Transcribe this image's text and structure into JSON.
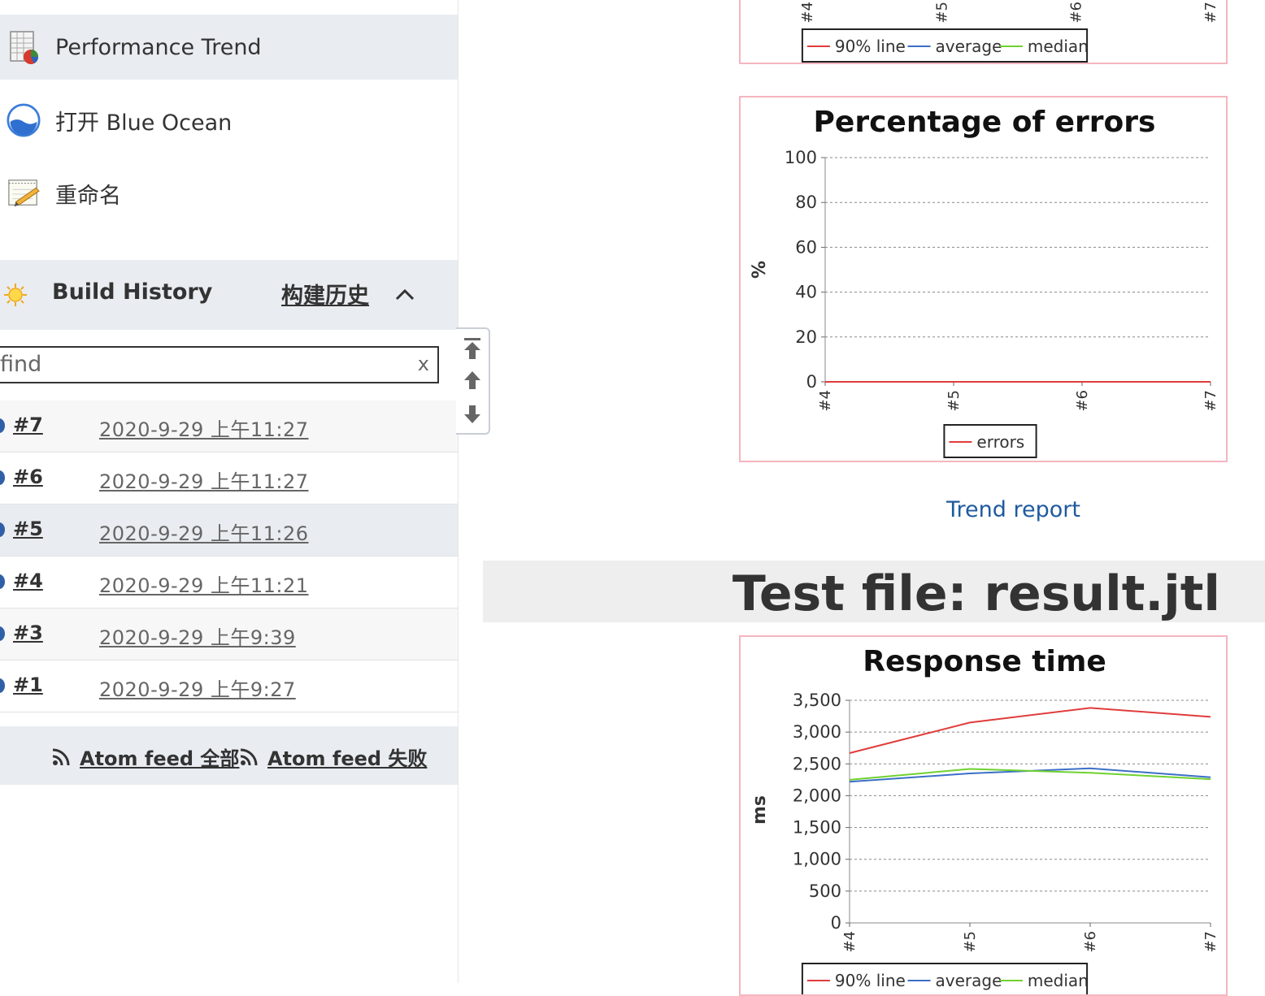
{
  "sidebar": {
    "tasks": [
      {
        "label": "Performance Trend",
        "icon": "performance-trend-icon"
      },
      {
        "label": "打开 Blue Ocean",
        "icon": "blue-ocean-icon"
      },
      {
        "label": "重命名",
        "icon": "rename-icon"
      }
    ],
    "build_history": {
      "title": "Build History",
      "link": "构建历史",
      "icon": "sun-icon",
      "collapse_icon": "chevron-up-icon",
      "search_placeholder": "find",
      "clear_label": "x",
      "builds": [
        {
          "number": "#7",
          "date": "2020-9-29 上午11:27"
        },
        {
          "number": "#6",
          "date": "2020-9-29 上午11:27"
        },
        {
          "number": "#5",
          "date": "2020-9-29 上午11:26"
        },
        {
          "number": "#4",
          "date": "2020-9-29 上午11:21"
        },
        {
          "number": "#3",
          "date": "2020-9-29 上午9:39"
        },
        {
          "number": "#1",
          "date": "2020-9-29 上午9:27"
        }
      ]
    },
    "atom_feeds": [
      {
        "label": "Atom feed 全部",
        "icon": "rss-icon"
      },
      {
        "label": "Atom feed 失败",
        "icon": "rss-icon"
      }
    ]
  },
  "main": {
    "trend_link": "Trend report",
    "test_file_heading": "Test file: result.jtl"
  },
  "colors": {
    "line_90": "#e03c3c",
    "line_average": "#3b6fc6",
    "line_median": "#6fd12f",
    "errors": "#e03c3c",
    "chart_border": "#f4b6c0",
    "link_blue": "#1f5a9f"
  },
  "chart_data": [
    {
      "type": "line",
      "partial": true,
      "x": [
        "#4",
        "#5",
        "#6",
        "#7"
      ],
      "legend": [
        "90% line",
        "average",
        "median"
      ]
    },
    {
      "type": "line",
      "title": "Percentage of errors",
      "ylabel": "%",
      "x": [
        "#4",
        "#5",
        "#6",
        "#7"
      ],
      "ylim": [
        0,
        100
      ],
      "yticks": [
        "0",
        "20",
        "40",
        "60",
        "80",
        "100"
      ],
      "series": [
        {
          "name": "errors",
          "values": [
            0,
            0,
            0,
            0
          ]
        }
      ],
      "grid": true,
      "legend_position": "bottom"
    },
    {
      "type": "line",
      "title": "Response time",
      "ylabel": "ms",
      "x": [
        "#4",
        "#5",
        "#6",
        "#7"
      ],
      "ylim": [
        0,
        3500
      ],
      "yticks": [
        "0",
        "500",
        "1,000",
        "1,500",
        "2,000",
        "2,500",
        "3,000",
        "3,500"
      ],
      "series": [
        {
          "name": "90% line",
          "values": [
            2670,
            3150,
            3380,
            3240
          ]
        },
        {
          "name": "average",
          "values": [
            2220,
            2350,
            2430,
            2290
          ]
        },
        {
          "name": "median",
          "values": [
            2250,
            2420,
            2360,
            2260
          ]
        }
      ],
      "grid": true,
      "legend_position": "bottom"
    }
  ]
}
